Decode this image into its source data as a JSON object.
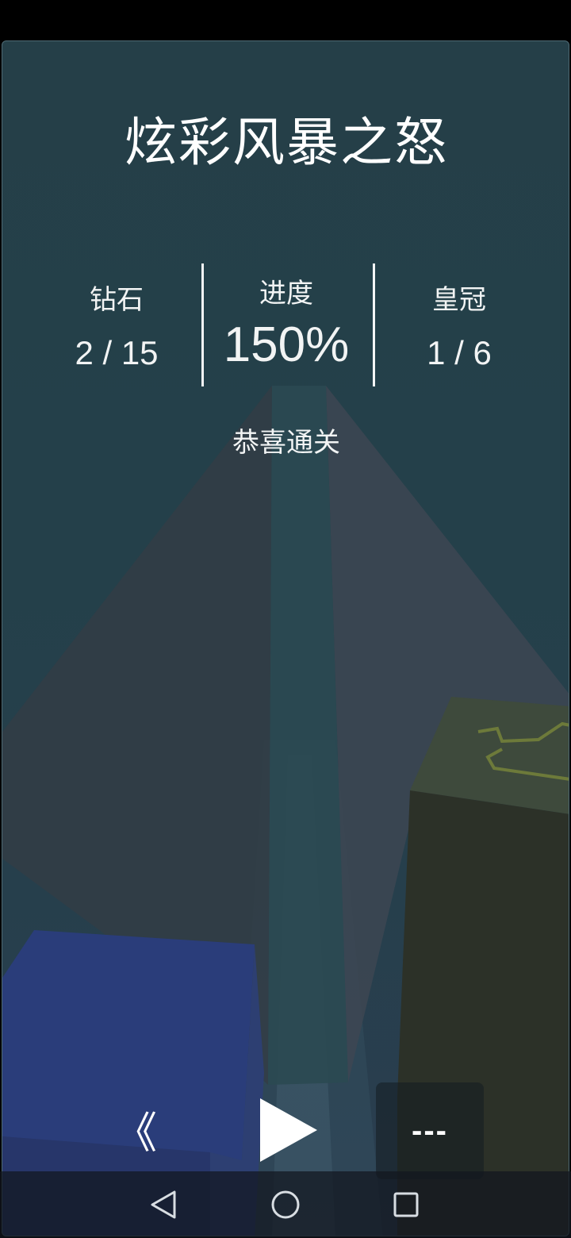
{
  "level": {
    "title": "炫彩风暴之怒"
  },
  "stats": {
    "diamonds": {
      "label": "钻石",
      "value": "2 / 15"
    },
    "progress": {
      "label": "进度",
      "value": "150%"
    },
    "crowns": {
      "label": "皇冠",
      "value": "1 / 6"
    }
  },
  "status_text": "恭喜通关",
  "controls": {
    "back_label": "《",
    "play_icon": "play-icon",
    "menu_label": "---"
  },
  "system_nav": {
    "back_icon": "nav-back-icon",
    "home_icon": "nav-home-icon",
    "recents_icon": "nav-recents-icon"
  },
  "colors": {
    "panel_background": "#243f49",
    "text": "#ffffff",
    "blue_block": "#2a3d7a",
    "olive_block": "#3e4a3c"
  }
}
